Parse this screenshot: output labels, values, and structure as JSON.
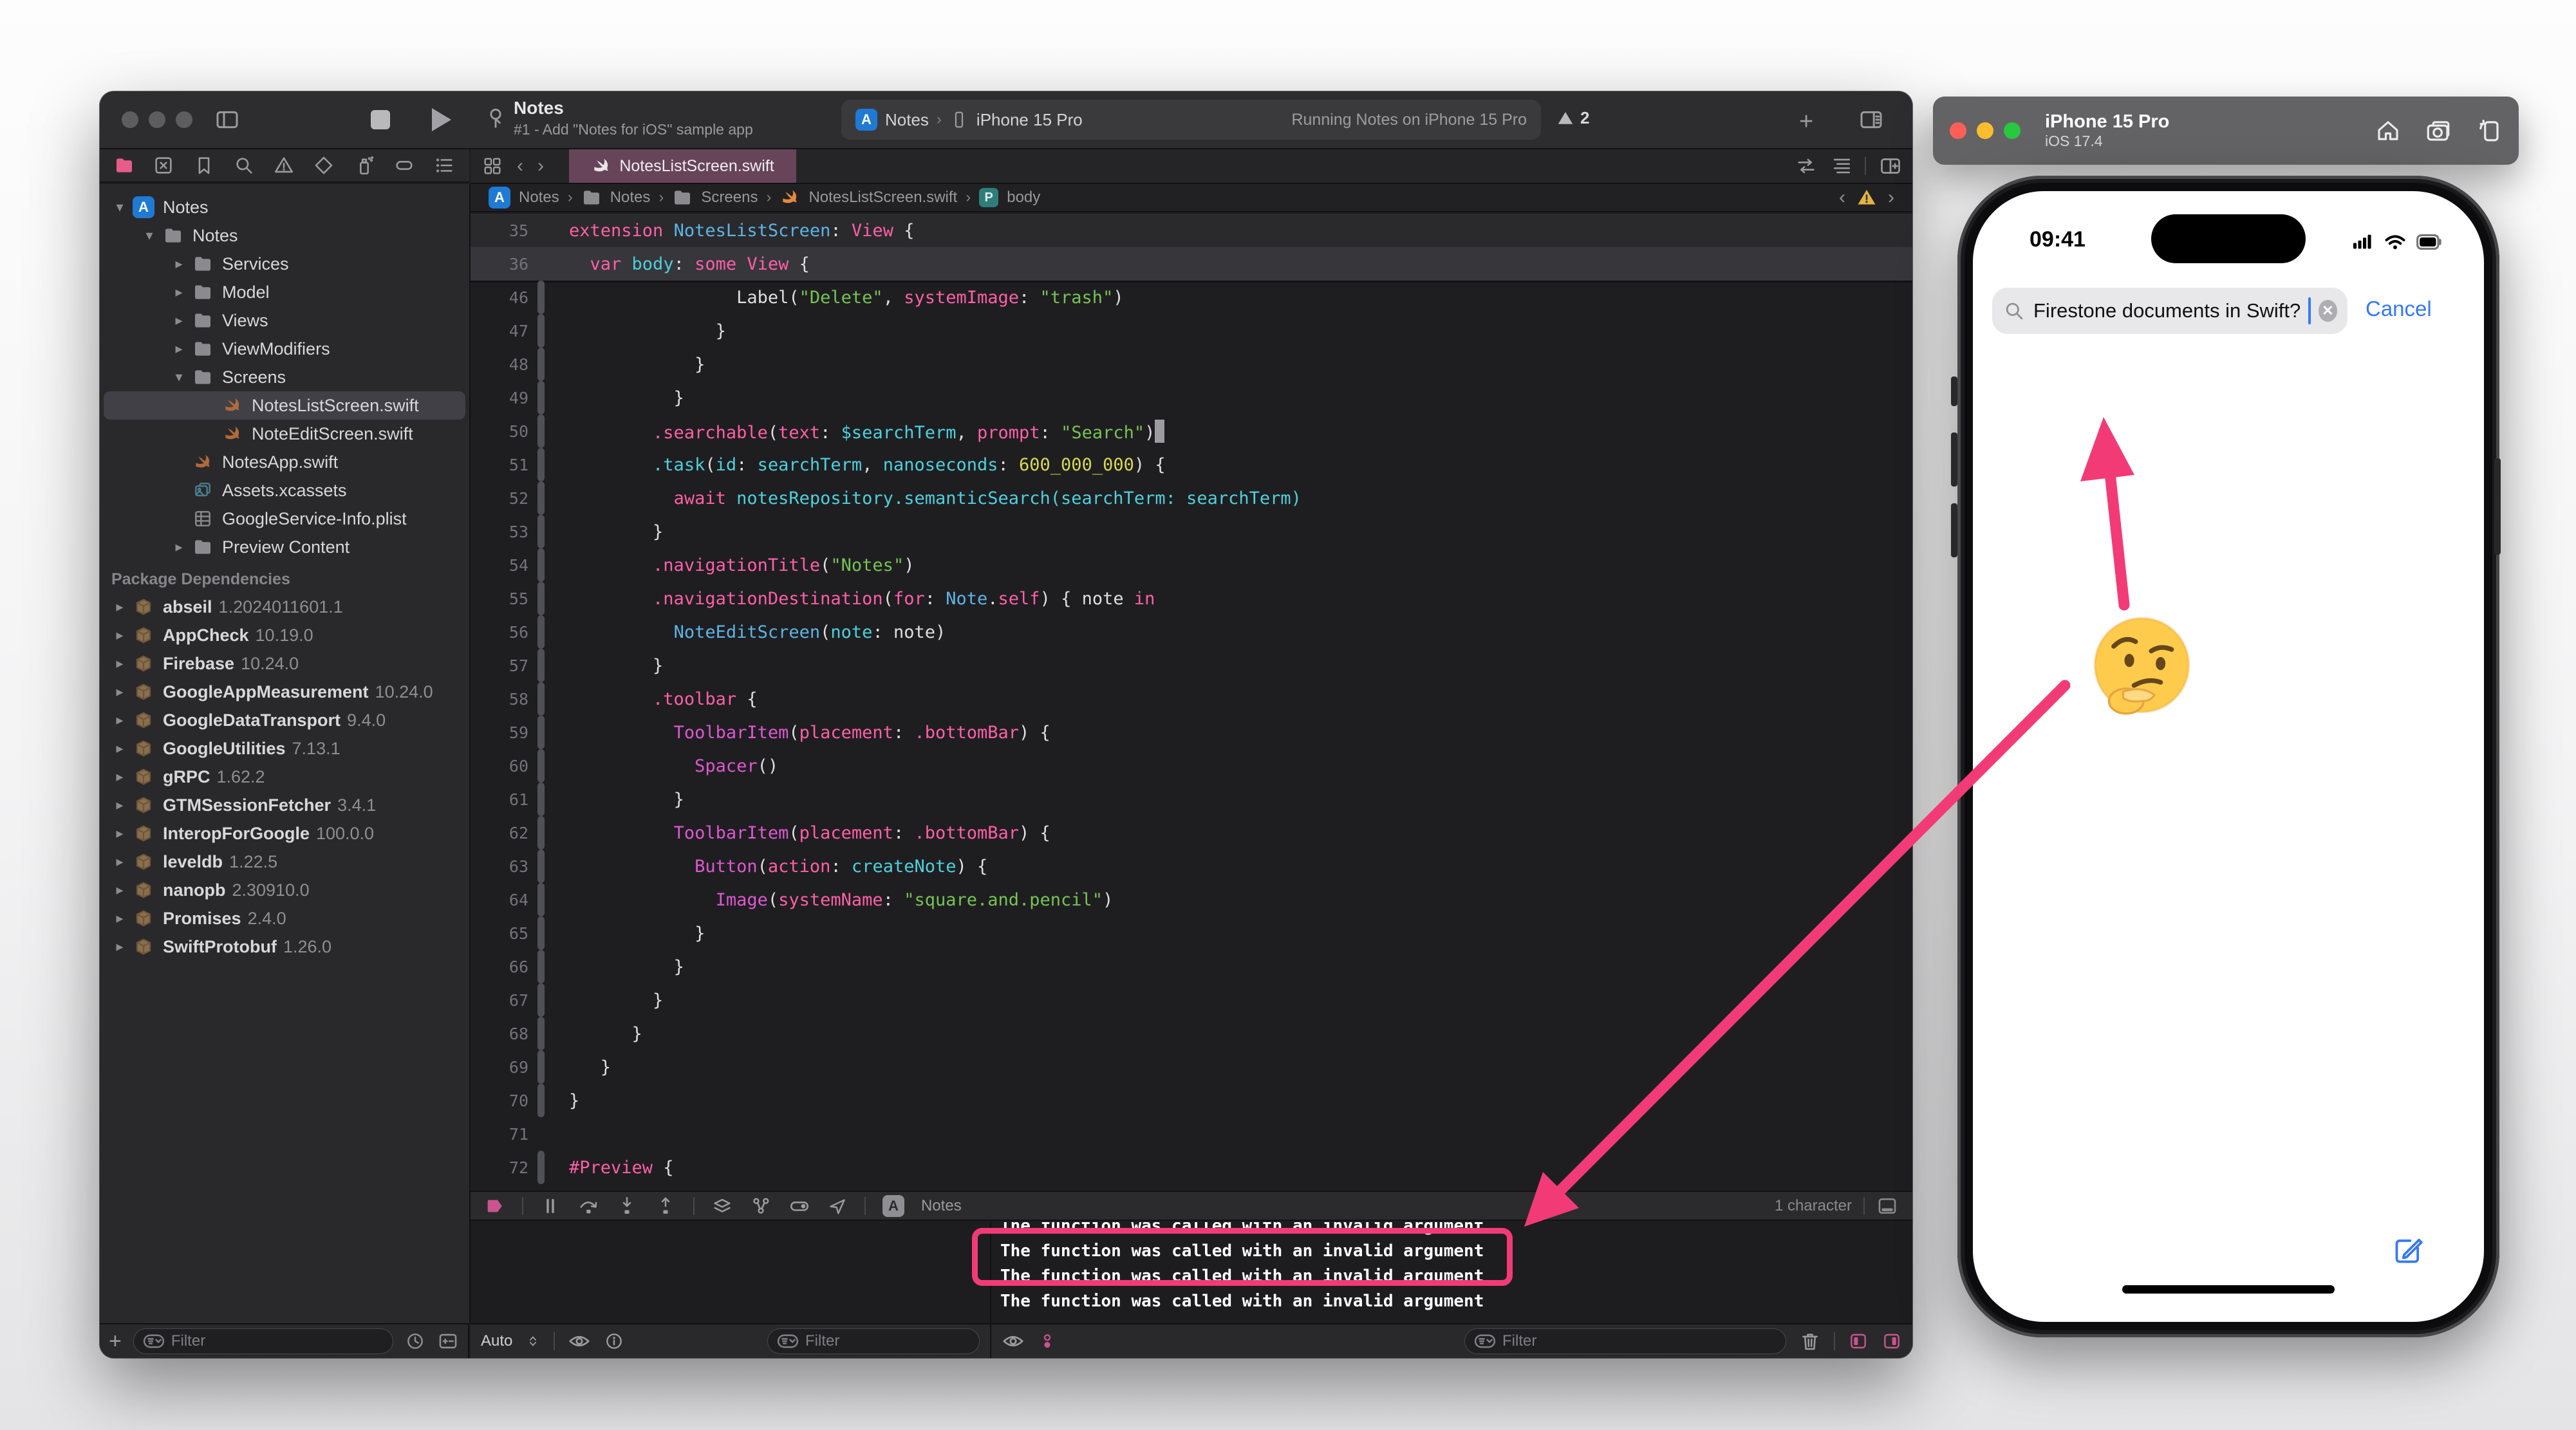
{
  "xcode": {
    "toolbar": {
      "title": "Notes",
      "subtitle": "#1 - Add \"Notes for iOS\" sample app",
      "scheme_app": "Notes",
      "scheme_device": "iPhone 15 Pro",
      "run_status": "Running Notes on iPhone 15 Pro",
      "warning_count": "2"
    },
    "tab": {
      "label": "NotesListScreen.swift"
    },
    "breadcrumbs": {
      "items": [
        "Notes",
        "Notes",
        "Screens",
        "NotesListScreen.swift",
        "body"
      ]
    },
    "navigator": {
      "tree": [
        {
          "label": "Notes",
          "icon": "appstore",
          "level": 0,
          "chev": "open"
        },
        {
          "label": "Notes",
          "icon": "folder",
          "level": 1,
          "chev": "open"
        },
        {
          "label": "Services",
          "icon": "folder",
          "level": 2,
          "chev": "closed"
        },
        {
          "label": "Model",
          "icon": "folder",
          "level": 2,
          "chev": "closed"
        },
        {
          "label": "Views",
          "icon": "folder",
          "level": 2,
          "chev": "closed"
        },
        {
          "label": "ViewModifiers",
          "icon": "folder",
          "level": 2,
          "chev": "closed"
        },
        {
          "label": "Screens",
          "icon": "folder",
          "level": 2,
          "chev": "open"
        },
        {
          "label": "NotesListScreen.swift",
          "icon": "swift",
          "level": 3,
          "selected": true
        },
        {
          "label": "NoteEditScreen.swift",
          "icon": "swift",
          "level": 3
        },
        {
          "label": "NotesApp.swift",
          "icon": "swift",
          "level": 2
        },
        {
          "label": "Assets.xcassets",
          "icon": "assets",
          "level": 2
        },
        {
          "label": "GoogleService-Info.plist",
          "icon": "plist",
          "level": 2
        },
        {
          "label": "Preview Content",
          "icon": "folder",
          "level": 2,
          "chev": "closed"
        }
      ],
      "packages_header": "Package Dependencies",
      "packages": [
        {
          "name": "abseil",
          "version": "1.2024011601.1"
        },
        {
          "name": "AppCheck",
          "version": "10.19.0"
        },
        {
          "name": "Firebase",
          "version": "10.24.0"
        },
        {
          "name": "GoogleAppMeasurement",
          "version": "10.24.0"
        },
        {
          "name": "GoogleDataTransport",
          "version": "9.4.0"
        },
        {
          "name": "GoogleUtilities",
          "version": "7.13.1"
        },
        {
          "name": "gRPC",
          "version": "1.62.2"
        },
        {
          "name": "GTMSessionFetcher",
          "version": "3.4.1"
        },
        {
          "name": "InteropForGoogle",
          "version": "100.0.0"
        },
        {
          "name": "leveldb",
          "version": "1.22.5"
        },
        {
          "name": "nanopb",
          "version": "2.30910.0"
        },
        {
          "name": "Promises",
          "version": "2.4.0"
        },
        {
          "name": "SwiftProtobuf",
          "version": "1.26.0"
        }
      ],
      "filter_placeholder": "Filter"
    },
    "code": {
      "lines": [
        {
          "n": 35,
          "ind": 0,
          "sticky": 1,
          "tk": [
            [
              "kw",
              "extension "
            ],
            [
              "type",
              "NotesListScreen"
            ],
            [
              "pl",
              ": "
            ],
            [
              "kw",
              "View"
            ],
            [
              "pl",
              " {"
            ]
          ]
        },
        {
          "n": 36,
          "ind": 2,
          "sticky": 2,
          "tk": [
            [
              "kw",
              "var "
            ],
            [
              "id",
              "body"
            ],
            [
              "pl",
              ": "
            ],
            [
              "kw",
              "some View"
            ],
            [
              "pl",
              " {"
            ]
          ]
        },
        {
          "n": 46,
          "ind": 16,
          "rb": 1,
          "tk": [
            [
              "pl",
              "Label("
            ],
            [
              "str",
              "\"Delete\""
            ],
            [
              "pl",
              ", "
            ],
            [
              "kw",
              "systemImage"
            ],
            [
              "pl",
              ": "
            ],
            [
              "str",
              "\"trash\""
            ],
            [
              "pl",
              ")"
            ]
          ]
        },
        {
          "n": 47,
          "ind": 14,
          "rb": 1,
          "tk": [
            [
              "pl",
              "}"
            ]
          ]
        },
        {
          "n": 48,
          "ind": 12,
          "rb": 1,
          "tk": [
            [
              "pl",
              "}"
            ]
          ]
        },
        {
          "n": 49,
          "ind": 10,
          "rb": 1,
          "tk": [
            [
              "pl",
              "}"
            ]
          ]
        },
        {
          "n": 50,
          "ind": 8,
          "rb": 1,
          "tk": [
            [
              "kw",
              ".searchable"
            ],
            [
              "pl",
              "("
            ],
            [
              "kw",
              "text"
            ],
            [
              "pl",
              ": "
            ],
            [
              "id",
              "$searchTerm"
            ],
            [
              "pl",
              ", "
            ],
            [
              "kw",
              "prompt"
            ],
            [
              "pl",
              ": "
            ],
            [
              "str",
              "\"Search\""
            ],
            [
              "pl",
              ")"
            ],
            [
              "cur",
              ""
            ]
          ]
        },
        {
          "n": 51,
          "ind": 8,
          "rb": 1,
          "tk": [
            [
              "id",
              ".task"
            ],
            [
              "pl",
              "("
            ],
            [
              "id",
              "id"
            ],
            [
              "pl",
              ": "
            ],
            [
              "id",
              "searchTerm"
            ],
            [
              "pl",
              ", "
            ],
            [
              "id",
              "nanoseconds"
            ],
            [
              "pl",
              ": "
            ],
            [
              "num",
              "600_000_000"
            ],
            [
              "pl",
              ") {"
            ]
          ]
        },
        {
          "n": 52,
          "ind": 10,
          "rb": 1,
          "tk": [
            [
              "kw",
              "await "
            ],
            [
              "id",
              "notesRepository.semanticSearch(searchTerm: searchTerm)"
            ]
          ]
        },
        {
          "n": 53,
          "ind": 8,
          "rb": 1,
          "tk": [
            [
              "pl",
              "}"
            ]
          ]
        },
        {
          "n": 54,
          "ind": 8,
          "rb": 1,
          "tk": [
            [
              "kw",
              ".navigationTitle"
            ],
            [
              "pl",
              "("
            ],
            [
              "str",
              "\"Notes\""
            ],
            [
              "pl",
              ")"
            ]
          ]
        },
        {
          "n": 55,
          "ind": 8,
          "rb": 1,
          "tk": [
            [
              "kw",
              ".navigationDestination"
            ],
            [
              "pl",
              "("
            ],
            [
              "kw",
              "for"
            ],
            [
              "pl",
              ": "
            ],
            [
              "type",
              "Note"
            ],
            [
              "pl",
              "."
            ],
            [
              "kw",
              "self"
            ],
            [
              "pl",
              ") { note "
            ],
            [
              "kw",
              "in"
            ]
          ]
        },
        {
          "n": 56,
          "ind": 10,
          "rb": 1,
          "tk": [
            [
              "type",
              "NoteEditScreen"
            ],
            [
              "pl",
              "("
            ],
            [
              "id",
              "note"
            ],
            [
              "pl",
              ": note)"
            ]
          ]
        },
        {
          "n": 57,
          "ind": 8,
          "rb": 1,
          "tk": [
            [
              "pl",
              "}"
            ]
          ]
        },
        {
          "n": 58,
          "ind": 8,
          "rb": 1,
          "tk": [
            [
              "kw",
              ".toolbar"
            ],
            [
              "pl",
              " {"
            ]
          ]
        },
        {
          "n": 59,
          "ind": 10,
          "rb": 1,
          "tk": [
            [
              "sys",
              "ToolbarItem"
            ],
            [
              "pl",
              "("
            ],
            [
              "kw",
              "placement"
            ],
            [
              "pl",
              ": "
            ],
            [
              "kw",
              ".bottomBar"
            ],
            [
              "pl",
              ") {"
            ]
          ]
        },
        {
          "n": 60,
          "ind": 12,
          "rb": 1,
          "tk": [
            [
              "sys",
              "Spacer"
            ],
            [
              "pl",
              "()"
            ]
          ]
        },
        {
          "n": 61,
          "ind": 10,
          "rb": 1,
          "tk": [
            [
              "pl",
              "}"
            ]
          ]
        },
        {
          "n": 62,
          "ind": 10,
          "rb": 1,
          "tk": [
            [
              "sys",
              "ToolbarItem"
            ],
            [
              "pl",
              "("
            ],
            [
              "kw",
              "placement"
            ],
            [
              "pl",
              ": "
            ],
            [
              "kw",
              ".bottomBar"
            ],
            [
              "pl",
              ") {"
            ]
          ]
        },
        {
          "n": 63,
          "ind": 12,
          "rb": 1,
          "tk": [
            [
              "sys",
              "Button"
            ],
            [
              "pl",
              "("
            ],
            [
              "kw",
              "action"
            ],
            [
              "pl",
              ": "
            ],
            [
              "id",
              "createNote"
            ],
            [
              "pl",
              ") {"
            ]
          ]
        },
        {
          "n": 64,
          "ind": 14,
          "rb": 1,
          "tk": [
            [
              "sys",
              "Image"
            ],
            [
              "pl",
              "("
            ],
            [
              "kw",
              "systemName"
            ],
            [
              "pl",
              ": "
            ],
            [
              "str",
              "\"square.and.pencil\""
            ],
            [
              "pl",
              ")"
            ]
          ]
        },
        {
          "n": 65,
          "ind": 12,
          "rb": 1,
          "tk": [
            [
              "pl",
              "}"
            ]
          ]
        },
        {
          "n": 66,
          "ind": 10,
          "rb": 1,
          "tk": [
            [
              "pl",
              "}"
            ]
          ]
        },
        {
          "n": 67,
          "ind": 8,
          "rb": 1,
          "tk": [
            [
              "pl",
              "}"
            ]
          ]
        },
        {
          "n": 68,
          "ind": 6,
          "rb": 1,
          "tk": [
            [
              "pl",
              "}"
            ]
          ]
        },
        {
          "n": 69,
          "ind": 3,
          "rb": 1,
          "tk": [
            [
              "pl",
              "}"
            ]
          ]
        },
        {
          "n": 70,
          "ind": 0,
          "rb": 1,
          "tk": [
            [
              "pl",
              "}"
            ]
          ]
        },
        {
          "n": 71,
          "ind": 0,
          "rb": 0,
          "tk": []
        },
        {
          "n": 72,
          "ind": 0,
          "rb": 1,
          "tk": [
            [
              "kw",
              "#Preview"
            ],
            [
              "pl",
              " {"
            ]
          ]
        }
      ]
    },
    "debugbar": {
      "app_label": "Notes",
      "char_count": "1 character"
    },
    "console": {
      "auto_label": "Auto",
      "messages": [
        "The function was called with an invalid argument",
        "The function was called with an invalid argument",
        "The function was called with an invalid argument",
        "The function was called with an invalid argument"
      ],
      "filter_placeholder": "Filter"
    }
  },
  "simulator": {
    "title": "iPhone 15 Pro",
    "os": "iOS 17.4",
    "time": "09:41",
    "search_text": "Firestone documents in Swift?",
    "cancel_label": "Cancel"
  },
  "annotations": {
    "highlight_color": "#f23b76",
    "emoji": "thinking-face"
  }
}
